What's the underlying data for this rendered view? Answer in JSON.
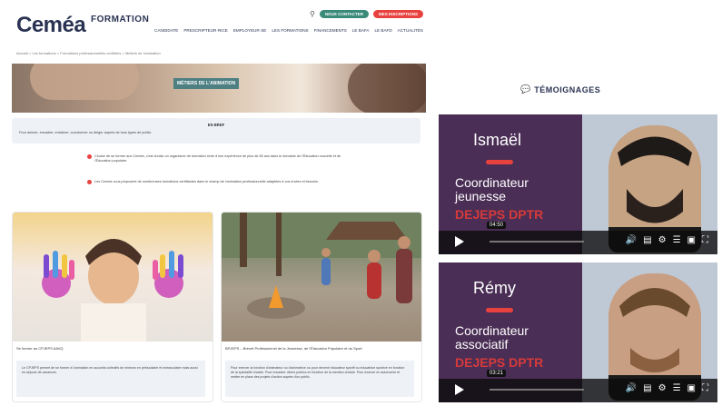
{
  "site": {
    "logo": {
      "brand": "Ceméa",
      "suffix": "FORMATION"
    },
    "buttons": {
      "connect": "NOUS CONTACTER",
      "register": "MES INSCRIPTIONS"
    },
    "nav": [
      "CANDIDATE",
      "PRESCRIPTEUR·RICE",
      "EMPLOYEUR·SE",
      "LES FORMATIONS",
      "FINANCEMENTS",
      "LE BAFA",
      "LE BAFD",
      "ACTUALITÉS"
    ],
    "breadcrumb": "Accueil  >  Les formations  >  Formations professionnelles certifiées  >  Métiers de l'animation",
    "hero_tag": "MÉTIERS DE L'ANIMATION",
    "brief": {
      "title": "EN BREF",
      "desc": "Pour animer, encadrer, entraîner, coordonner ou diriger auprès de tous types de public."
    },
    "paragraphs": [
      "Choisir de se former aux Ceméa, c'est choisir un organisme de formation riche d'une expérience de plus de 80 ans dans le domaine de l'Éducation nouvelle et de l'Éducation populaire.",
      "Les Ceméa vous proposent de nombreuses formations certifiantes dans le champ de l'animation professionnelle adaptées à vos envies et besoins."
    ],
    "cards": [
      {
        "caption": "Se former au CPJEPS AAVQ",
        "text": "Le CPJEPS permet de se former à l'animation en accueils collectifs de mineurs en périscolaire et extrascolaire mais aussi en séjours de vacances."
      },
      {
        "caption": "BPJEPS – Brevet Professionnel de la Jeunesse, de l'Éducation Populaire et du Sport",
        "text": "Pour exercer la fonction d'animateur ou d'animatrice ou pour devenir éducateur sportif ou éducatrice sportive en fonction de la spécialité choisie. Pour encadrer divers publics en fonction de la mention choisie. Pour exercer en autonomie et mettre en place des projets d'action auprès d'un public."
      }
    ]
  },
  "testimonials": {
    "label": "TÉMOIGNAGES",
    "videos": [
      {
        "name": "Ismaël",
        "role": [
          "Coordinateur",
          "jeunesse"
        ],
        "diploma": "DEJEPS DPTR",
        "time": "04:50"
      },
      {
        "name": "Rémy",
        "role": [
          "Coordinateur",
          "associatif"
        ],
        "diploma": "DEJEPS DPTR",
        "time": "03:21"
      }
    ]
  },
  "colors": {
    "brand": "#2a3352",
    "accent": "#e8423f",
    "green": "#3a8a7a",
    "panel": "#4a2e55"
  }
}
